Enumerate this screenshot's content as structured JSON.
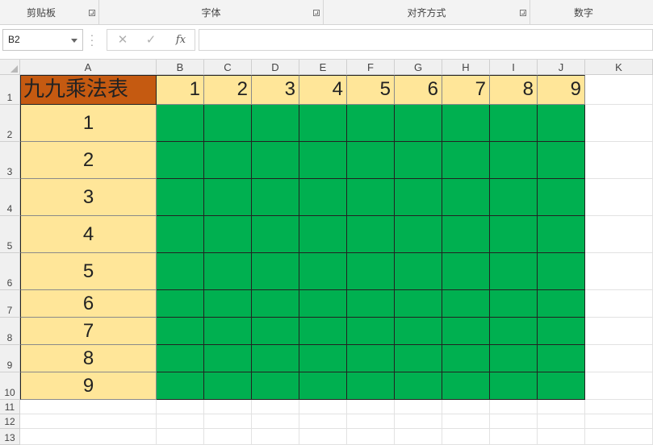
{
  "ribbon": {
    "groups": [
      {
        "label": "剪贴板"
      },
      {
        "label": "字体"
      },
      {
        "label": "对齐方式"
      },
      {
        "label": "数字"
      }
    ]
  },
  "formula_bar": {
    "name_box": "B2",
    "cancel_icon": "cancel-icon",
    "enter_icon": "check-icon",
    "fx_label": "fx",
    "formula_value": ""
  },
  "sheet": {
    "columns": [
      "A",
      "B",
      "C",
      "D",
      "E",
      "F",
      "G",
      "H",
      "I",
      "J",
      "K"
    ],
    "rows": [
      "1",
      "2",
      "3",
      "4",
      "5",
      "6",
      "7",
      "8",
      "9",
      "10",
      "11",
      "12",
      "13"
    ],
    "title": "九九乘法表",
    "header_numbers": [
      "1",
      "2",
      "3",
      "4",
      "5",
      "6",
      "7",
      "8",
      "9"
    ],
    "row_numbers": [
      "1",
      "2",
      "3",
      "4",
      "5",
      "6",
      "7",
      "8",
      "9"
    ],
    "colors": {
      "title_fill": "#c55a11",
      "header_fill": "#ffe699",
      "body_fill": "#00b050"
    }
  }
}
